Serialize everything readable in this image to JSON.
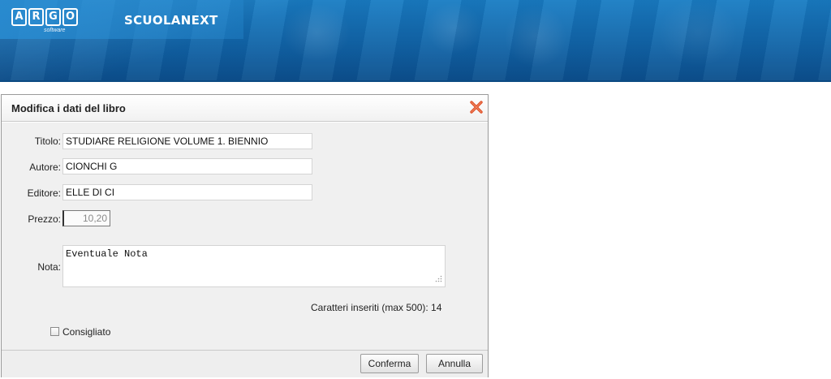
{
  "header": {
    "logo_letters": [
      "A",
      "R",
      "G",
      "O"
    ],
    "logo_sub": "software",
    "app_name": "SCUOLANEXT"
  },
  "dialog": {
    "title": "Modifica i dati del libro",
    "close_icon": "close-x-icon",
    "fields": {
      "titolo": {
        "label": "Titolo:",
        "value": "STUDIARE RELIGIONE VOLUME 1. BIENNIO"
      },
      "autore": {
        "label": "Autore:",
        "value": "CIONCHI G"
      },
      "editore": {
        "label": "Editore:",
        "value": "ELLE DI CI"
      },
      "prezzo": {
        "label": "Prezzo:",
        "value": "10,20"
      },
      "nota": {
        "label": "Nota:",
        "value": "Eventuale Nota"
      }
    },
    "char_counter": "Caratteri inseriti (max 500): 14",
    "consigliato": {
      "label": "Consigliato",
      "checked": false
    },
    "buttons": {
      "confirm": "Conferma",
      "cancel": "Annulla"
    }
  },
  "colors": {
    "banner": "#1265a8",
    "close_icon": "#e0522a"
  }
}
